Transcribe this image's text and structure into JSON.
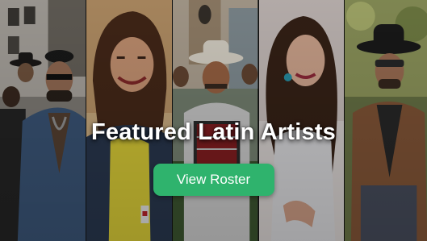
{
  "banner": {
    "headline": "Featured Latin Artists",
    "cta_label": "View Roster",
    "accent_color": "#2fb36d",
    "photos": [
      {
        "name": "artist-photo-1",
        "description_icon": "band-group-photo"
      },
      {
        "name": "artist-photo-2",
        "description_icon": "woman-smiling-photo"
      },
      {
        "name": "artist-photo-3",
        "description_icon": "cowboy-with-accordion-photo"
      },
      {
        "name": "artist-photo-4",
        "description_icon": "woman-singer-photo"
      },
      {
        "name": "artist-photo-5",
        "description_icon": "cowboy-hat-man-photo"
      }
    ]
  }
}
